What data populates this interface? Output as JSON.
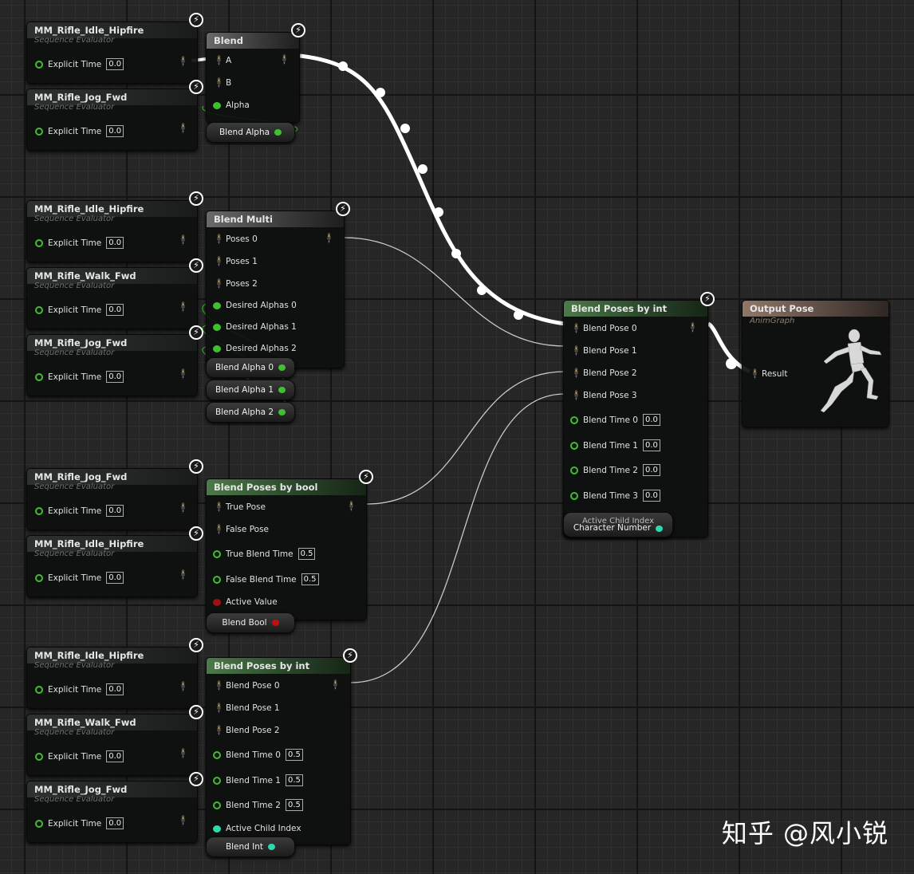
{
  "graph": {
    "seq_subtitle": "Sequence Evaluator",
    "explicit_time_label": "Explicit Time",
    "seq_nodes": [
      {
        "title": "MM_Rifle_Idle_Hipfire",
        "value": "0.0"
      },
      {
        "title": "MM_Rifle_Jog_Fwd",
        "value": "0.0"
      },
      {
        "title": "MM_Rifle_Idle_Hipfire",
        "value": "0.0"
      },
      {
        "title": "MM_Rifle_Walk_Fwd",
        "value": "0.0"
      },
      {
        "title": "MM_Rifle_Jog_Fwd",
        "value": "0.0"
      },
      {
        "title": "MM_Rifle_Jog_Fwd",
        "value": "0.0"
      },
      {
        "title": "MM_Rifle_Idle_Hipfire",
        "value": "0.0"
      },
      {
        "title": "MM_Rifle_Idle_Hipfire",
        "value": "0.0"
      },
      {
        "title": "MM_Rifle_Walk_Fwd",
        "value": "0.0"
      },
      {
        "title": "MM_Rifle_Jog_Fwd",
        "value": "0.0"
      }
    ],
    "blend": {
      "title": "Blend",
      "pins": [
        "A",
        "B",
        "Alpha"
      ],
      "alpha_node": "Blend Alpha"
    },
    "blend_multi": {
      "title": "Blend Multi",
      "pins": [
        "Poses 0",
        "Poses 1",
        "Poses 2",
        "Desired Alphas 0",
        "Desired Alphas 1",
        "Desired Alphas 2"
      ],
      "alpha_nodes": [
        "Blend Alpha 0",
        "Blend Alpha 1",
        "Blend Alpha 2"
      ]
    },
    "blend_bool": {
      "title": "Blend Poses by bool",
      "pins": [
        "True Pose",
        "False Pose",
        "True Blend Time",
        "False Blend Time",
        "Active Value"
      ],
      "true_time": "0.5",
      "false_time": "0.5",
      "bool_node": "Blend Bool"
    },
    "blend_int_lower": {
      "title": "Blend Poses by int",
      "pins": [
        "Blend Pose 0",
        "Blend Pose 1",
        "Blend Pose 2",
        "Blend Time 0",
        "Blend Time 1",
        "Blend Time 2",
        "Active Child Index"
      ],
      "times": [
        "0.5",
        "0.5",
        "0.5"
      ],
      "int_node": "Blend Int"
    },
    "blend_int_main": {
      "title": "Blend Poses by int",
      "pins": [
        "Blend Pose 0",
        "Blend Pose 1",
        "Blend Pose 2",
        "Blend Pose 3",
        "Blend Time 0",
        "Blend Time 1",
        "Blend Time 2",
        "Blend Time 3"
      ],
      "times": [
        "0.0",
        "0.0",
        "0.0",
        "0.0"
      ],
      "index_node_line1": "Active Child Index",
      "index_node_line2": "Character Number"
    },
    "output": {
      "title": "Output Pose",
      "subtitle": "AnimGraph",
      "pin": "Result"
    }
  },
  "watermark": "知乎 @风小锐",
  "colors": {
    "exec_pin": "#3fbf2f",
    "bool_pin": "#a01010",
    "int_pin": "#2fd9b0",
    "header_green": "#4d7a4a",
    "header_gray": "#6a6a6a",
    "header_output": "#8f7868"
  }
}
